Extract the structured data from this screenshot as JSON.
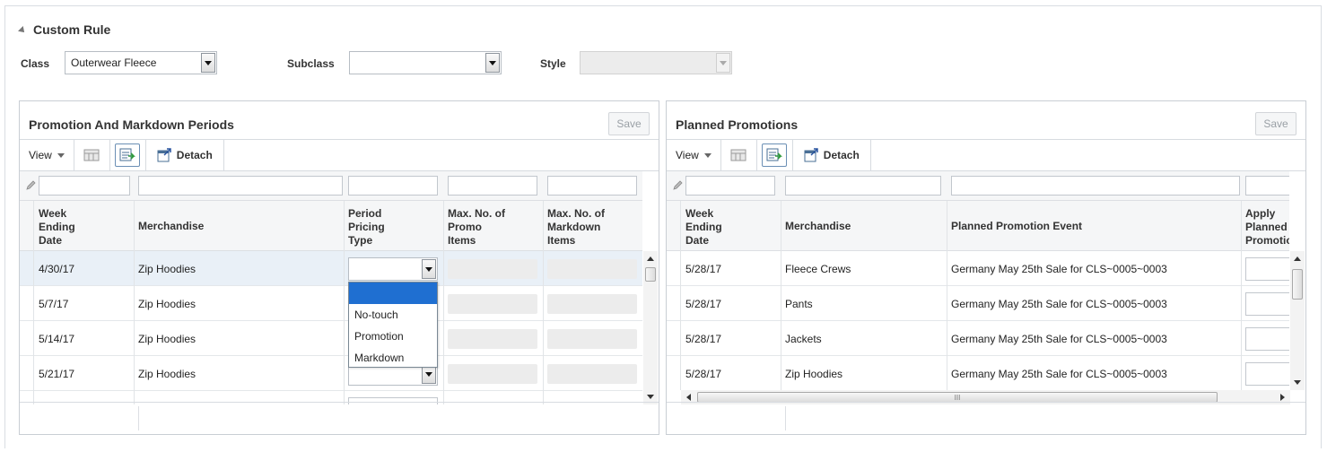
{
  "section": {
    "title": "Custom Rule"
  },
  "filters": {
    "class_label": "Class",
    "class_value": "Outerwear Fleece",
    "subclass_label": "Subclass",
    "subclass_value": "",
    "style_label": "Style",
    "style_value": ""
  },
  "left_panel": {
    "title": "Promotion And Markdown Periods",
    "save_label": "Save",
    "toolbar": {
      "view_label": "View",
      "detach_label": "Detach"
    },
    "columns": [
      {
        "lines": [
          "Week",
          "Ending",
          "Date"
        ]
      },
      {
        "lines": [
          "Merchandise"
        ]
      },
      {
        "lines": [
          "Period",
          "Pricing",
          "Type"
        ]
      },
      {
        "lines": [
          "Max. No. of",
          "Promo",
          "Items"
        ]
      },
      {
        "lines": [
          "Max. No. of",
          "Markdown",
          "Items"
        ]
      }
    ],
    "rows": [
      {
        "date": "4/30/17",
        "merchandise": "Zip Hoodies"
      },
      {
        "date": "5/7/17",
        "merchandise": "Zip Hoodies"
      },
      {
        "date": "5/14/17",
        "merchandise": "Zip Hoodies"
      },
      {
        "date": "5/21/17",
        "merchandise": "Zip Hoodies"
      }
    ],
    "pricing_dropdown": {
      "selected": "",
      "options": [
        "",
        "No-touch",
        "Promotion",
        "Markdown"
      ]
    }
  },
  "right_panel": {
    "title": "Planned Promotions",
    "save_label": "Save",
    "toolbar": {
      "view_label": "View",
      "detach_label": "Detach"
    },
    "columns": [
      {
        "lines": [
          "Week",
          "Ending",
          "Date"
        ]
      },
      {
        "lines": [
          "Merchandise"
        ]
      },
      {
        "lines": [
          "Planned Promotion Event"
        ]
      },
      {
        "lines": [
          "Apply",
          "Planned",
          "Promotion"
        ]
      }
    ],
    "rows": [
      {
        "date": "5/28/17",
        "merchandise": "Fleece Crews",
        "event": "Germany May 25th Sale for CLS~0005~0003"
      },
      {
        "date": "5/28/17",
        "merchandise": "Pants",
        "event": "Germany May 25th Sale for CLS~0005~0003"
      },
      {
        "date": "5/28/17",
        "merchandise": "Jackets",
        "event": "Germany May 25th Sale for CLS~0005~0003"
      },
      {
        "date": "5/28/17",
        "merchandise": "Zip Hoodies",
        "event": "Germany May 25th Sale for CLS~0005~0003"
      }
    ],
    "hscroll_grip": "III"
  },
  "icons": {
    "collapse": "triangle-icon",
    "view_caret": "caret-down-icon",
    "freeze": "freeze-column-icon",
    "export": "export-icon",
    "detach": "detach-icon",
    "filter": "pencil-icon"
  }
}
